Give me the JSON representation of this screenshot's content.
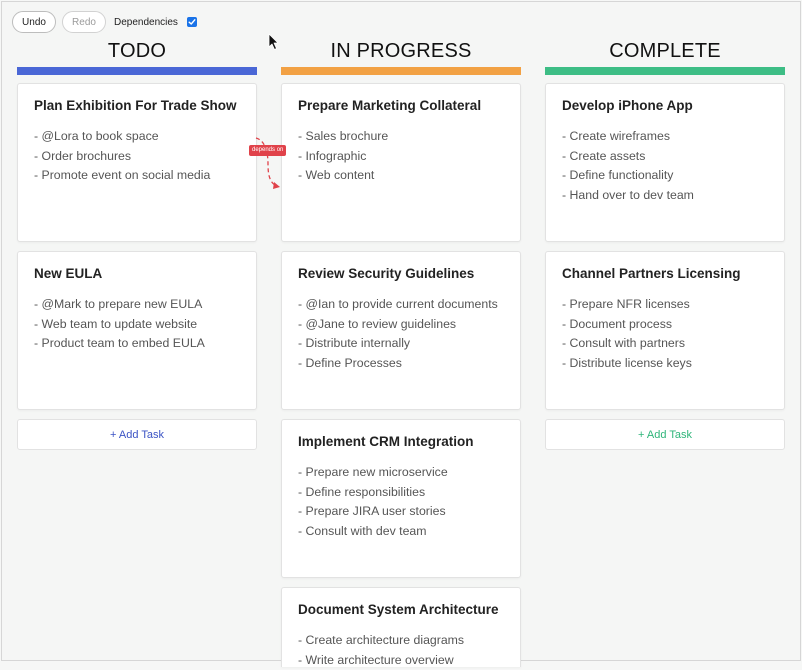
{
  "toolbar": {
    "undo_label": "Undo",
    "redo_label": "Redo",
    "dependencies_label": "Dependencies",
    "dependencies_checked": true
  },
  "colors": {
    "todo": "#4a67d6",
    "in_progress": "#f2a144",
    "complete": "#3dbd85",
    "add_task_todo": "#3b53c4",
    "add_task_complete": "#2fb57a",
    "dependency": "#e0424a"
  },
  "columns": [
    {
      "title": "TODO",
      "cards": [
        {
          "title": "Plan Exhibition For Trade Show",
          "items": [
            "- @Lora to book space",
            "- Order brochures",
            "- Promote event on social media"
          ]
        },
        {
          "title": "New EULA",
          "items": [
            "- @Mark to prepare new EULA",
            "- Web team to update website",
            "- Product team to embed EULA"
          ]
        }
      ],
      "add_task_label": "+ Add Task"
    },
    {
      "title": "IN PROGRESS",
      "cards": [
        {
          "title": "Prepare Marketing Collateral",
          "items": [
            "- Sales brochure",
            "- Infographic",
            "- Web content"
          ]
        },
        {
          "title": "Review Security Guidelines",
          "items": [
            "- @Ian to provide current documents",
            "- @Jane to review guidelines",
            "- Distribute internally",
            "- Define Processes"
          ]
        },
        {
          "title": "Implement CRM Integration",
          "items": [
            "- Prepare new microservice",
            "- Define responsibilities",
            "- Prepare JIRA user stories",
            "- Consult with dev team"
          ]
        },
        {
          "title": "Document System Architecture",
          "items": [
            "- Create architecture diagrams",
            "- Write architecture overview"
          ]
        }
      ]
    },
    {
      "title": "COMPLETE",
      "cards": [
        {
          "title": "Develop iPhone App",
          "items": [
            "- Create wireframes",
            "- Create assets",
            "- Define functionality",
            "- Hand over to dev team"
          ]
        },
        {
          "title": "Channel Partners Licensing",
          "items": [
            "- Prepare NFR licenses",
            "- Document process",
            "- Consult with partners",
            "- Distribute license keys"
          ]
        }
      ],
      "add_task_label": "+ Add Task"
    }
  ],
  "dependency_label": "depends on",
  "icons": {
    "check": "checkmark-icon",
    "cursor": "mouse-pointer-icon",
    "dependency": "dependency-arrow-icon"
  }
}
